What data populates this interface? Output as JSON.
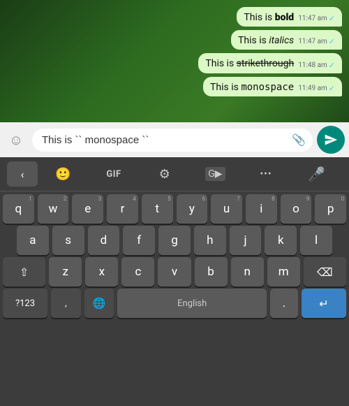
{
  "chat": {
    "messages": [
      {
        "id": "msg1",
        "prefix": "This is ",
        "highlighted": "bold",
        "suffix": "",
        "style": "bold",
        "time": "11:47 am",
        "ticks": "✓"
      },
      {
        "id": "msg2",
        "prefix": "This is ",
        "highlighted": "italics",
        "suffix": "",
        "style": "italic",
        "time": "11:47 am",
        "ticks": "✓"
      },
      {
        "id": "msg3",
        "prefix": "This is ",
        "highlighted": "strikethrough",
        "suffix": "",
        "style": "strike",
        "time": "11:48 am",
        "ticks": "✓"
      },
      {
        "id": "msg4",
        "prefix": "This is ",
        "highlighted": "monospace",
        "suffix": "",
        "style": "mono",
        "time": "11:49 am",
        "ticks": "✓"
      }
    ]
  },
  "input_bar": {
    "emoji_icon": "☺",
    "input_value": "This is `` monospace ``",
    "attach_icon": "📎",
    "send_icon": "send"
  },
  "keyboard_toolbar": {
    "back_label": "<",
    "sticker_icon": "😊",
    "gif_label": "GIF",
    "settings_icon": "⚙",
    "translate_icon": "G",
    "more_icon": "...",
    "mic_icon": "🎤"
  },
  "keyboard": {
    "rows": [
      {
        "keys": [
          {
            "letter": "q",
            "number": "1"
          },
          {
            "letter": "w",
            "number": "2"
          },
          {
            "letter": "e",
            "number": "3"
          },
          {
            "letter": "r",
            "number": "4"
          },
          {
            "letter": "t",
            "number": "5"
          },
          {
            "letter": "y",
            "number": "6"
          },
          {
            "letter": "u",
            "number": "7"
          },
          {
            "letter": "i",
            "number": "8"
          },
          {
            "letter": "o",
            "number": "9"
          },
          {
            "letter": "p",
            "number": "0"
          }
        ]
      },
      {
        "keys": [
          {
            "letter": "a",
            "number": ""
          },
          {
            "letter": "s",
            "number": ""
          },
          {
            "letter": "d",
            "number": ""
          },
          {
            "letter": "f",
            "number": ""
          },
          {
            "letter": "g",
            "number": ""
          },
          {
            "letter": "h",
            "number": ""
          },
          {
            "letter": "j",
            "number": ""
          },
          {
            "letter": "k",
            "number": ""
          },
          {
            "letter": "l",
            "number": ""
          }
        ]
      },
      {
        "special": true,
        "keys": [
          {
            "letter": "z",
            "number": ""
          },
          {
            "letter": "x",
            "number": ""
          },
          {
            "letter": "c",
            "number": ""
          },
          {
            "letter": "v",
            "number": ""
          },
          {
            "letter": "b",
            "number": ""
          },
          {
            "letter": "n",
            "number": ""
          },
          {
            "letter": "m",
            "number": ""
          }
        ]
      }
    ],
    "bottom_row": {
      "number_label": "?123",
      "emoji_label": ",",
      "globe_label": "🌐",
      "space_label": "English",
      "period_label": ".",
      "enter_label": "↵"
    }
  }
}
